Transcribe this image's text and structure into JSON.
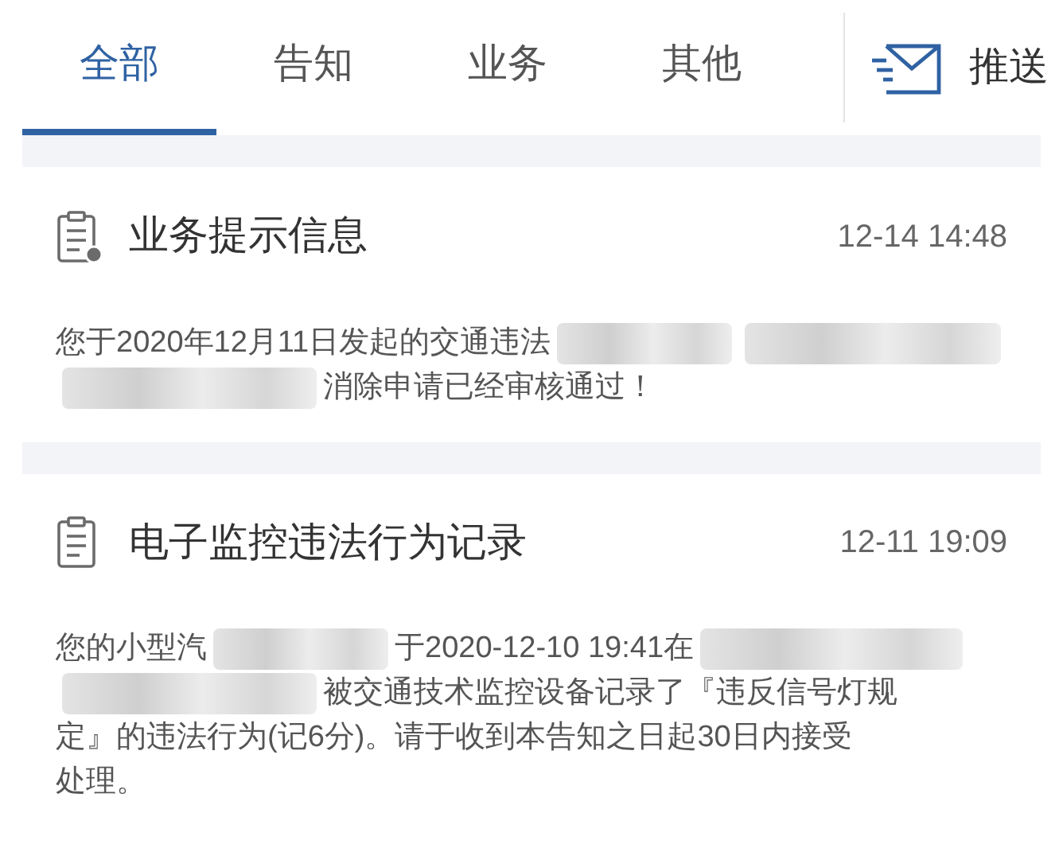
{
  "tabs": [
    {
      "label": "全部",
      "selected": true
    },
    {
      "label": "告知",
      "selected": false
    },
    {
      "label": "业务",
      "selected": false
    },
    {
      "label": "其他",
      "selected": false
    }
  ],
  "push_button": {
    "label": "推送"
  },
  "messages": [
    {
      "kind": "business",
      "title": "业务提示信息",
      "time": "12-14 14:48",
      "lines": [
        [
          {
            "kind": "text",
            "text": "您于2020年12月11日发起的交通违法"
          },
          {
            "kind": "redacted"
          },
          {
            "kind": "redacted"
          }
        ],
        [
          {
            "kind": "redacted"
          },
          {
            "kind": "text",
            "text": "消除申请已经审核通过！"
          }
        ]
      ]
    },
    {
      "kind": "notice",
      "title": "电子监控违法行为记录",
      "time": "12-11 19:09",
      "lines": [
        [
          {
            "kind": "text",
            "text": "您的小型汽"
          },
          {
            "kind": "redacted"
          },
          {
            "kind": "text",
            "text": "于2020-12-10 19:41在"
          },
          {
            "kind": "redacted"
          }
        ],
        [
          {
            "kind": "redacted"
          },
          {
            "kind": "text",
            "text": "被交通技术监控设备记录了『违反信号灯规"
          }
        ],
        [
          {
            "kind": "text",
            "text": "定』的违法行为(记6分)。请于收到本告知之日起30日内接受"
          }
        ],
        [
          {
            "kind": "text",
            "text": "处理。"
          }
        ]
      ]
    }
  ]
}
